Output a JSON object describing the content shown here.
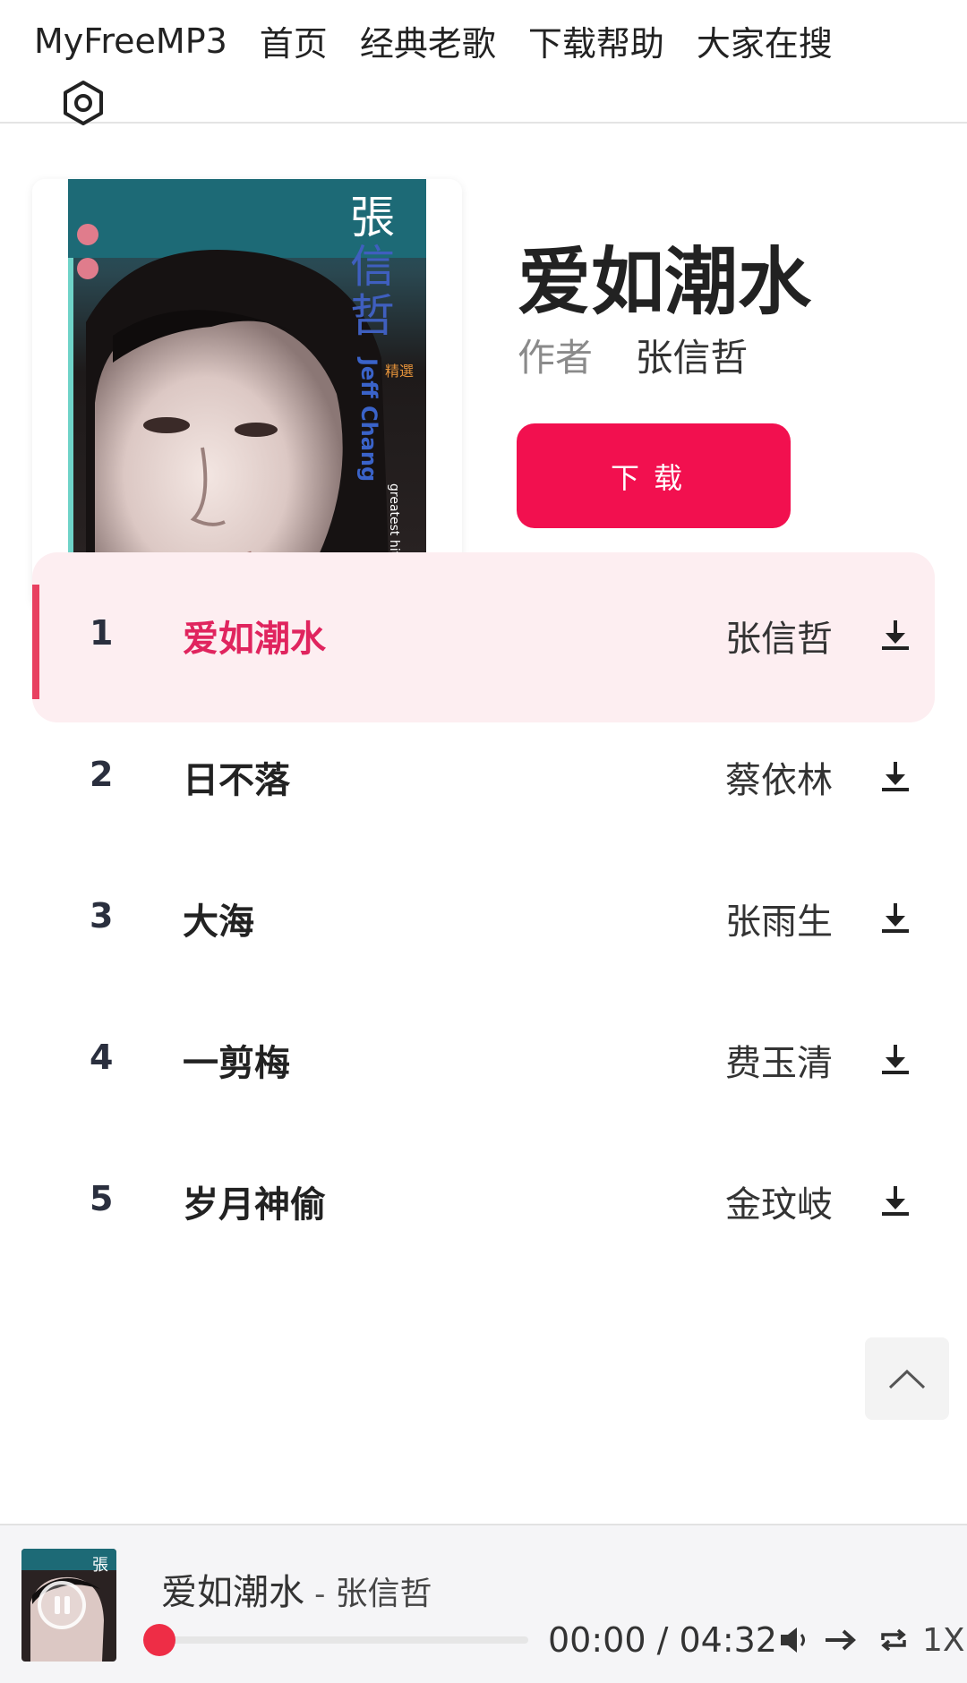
{
  "nav": {
    "links": [
      "MyFreeMP3",
      "首页",
      "经典老歌",
      "下载帮助",
      "大家在搜"
    ],
    "settings_icon": "gear-icon"
  },
  "song": {
    "title": "爱如潮水",
    "author_label": "作者",
    "author": "张信哲",
    "download_label": "下载",
    "cover_text": {
      "artist_cn": "張信哲",
      "artist_en": "Jeff Chang",
      "collection": "精選",
      "subtitle": "greatest hits"
    }
  },
  "tracks": [
    {
      "no": "1",
      "title": "爱如潮水",
      "artist": "张信哲",
      "active": true
    },
    {
      "no": "2",
      "title": "日不落",
      "artist": "蔡依林",
      "active": false
    },
    {
      "no": "3",
      "title": "大海",
      "artist": "张雨生",
      "active": false
    },
    {
      "no": "4",
      "title": "一剪梅",
      "artist": "费玉清",
      "active": false
    },
    {
      "no": "5",
      "title": "岁月神偷",
      "artist": "金玟岐",
      "active": false
    }
  ],
  "player": {
    "title": "爱如潮水",
    "separator": "-",
    "artist": "张信哲",
    "time": "00:00 / 04:32",
    "progress": 0,
    "speed": "1X",
    "mini_cover_text": "張"
  },
  "colors": {
    "accent": "#f2104f",
    "active_title": "#e0245e",
    "active_bg": "#fdeef1"
  }
}
